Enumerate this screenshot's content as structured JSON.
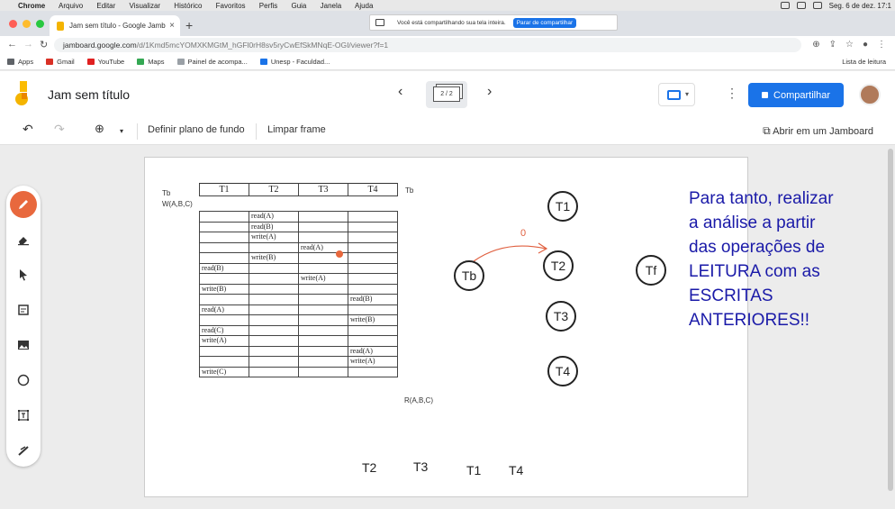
{
  "mac_menu": {
    "app": "Chrome",
    "items": [
      "Arquivo",
      "Editar",
      "Visualizar",
      "Histórico",
      "Favoritos",
      "Perfis",
      "Guia",
      "Janela",
      "Ajuda"
    ],
    "clock": "Seg. 6 de dez.  17:1"
  },
  "browser": {
    "tab_title": "Jam sem título - Google Jamb",
    "tab_close": "×",
    "new_tab": "+",
    "url_main": "jamboard.google.com",
    "url_path": "/d/1Kmd5mcYOMXKMGtM_hGFl0rH8sv5ryCwEfSkMNqE-OGI/viewer?f=1",
    "share_notice": "Você está compartilhando sua tela inteira.",
    "stop_sharing": "Parar de compartilhar",
    "bookmarks": [
      {
        "label": "Apps",
        "color": "#5f6368"
      },
      {
        "label": "Gmail",
        "color": "#d93025"
      },
      {
        "label": "YouTube",
        "color": "#e02020"
      },
      {
        "label": "Maps",
        "color": "#34a853"
      },
      {
        "label": "Painel de acompa...",
        "color": "#9aa0a6"
      },
      {
        "label": "Unesp - Faculdad...",
        "color": "#1a73e8"
      }
    ],
    "reading_list": "Lista de leitura"
  },
  "jam": {
    "title": "Jam sem título",
    "frame_counter": "2 / 2",
    "share_label": "Compartilhar",
    "accent": "#1a73e8"
  },
  "toolbar": {
    "set_background": "Definir plano de fundo",
    "clear_frame": "Limpar frame",
    "open_in_jamboard": "Abrir em um Jamboard"
  },
  "schedule": {
    "headers": [
      "T1",
      "T2",
      "T3",
      "T4"
    ],
    "left_label_tb": "Tb",
    "left_label_w": "W(A,B,C)",
    "right_label_tb": "Tb",
    "bottom_label_r": "R(A,B,C)",
    "rows": [
      [
        "",
        "read(A)",
        "",
        ""
      ],
      [
        "",
        "read(B)",
        "",
        ""
      ],
      [
        "",
        "write(A)",
        "",
        ""
      ],
      [
        "",
        "",
        "read(A)",
        ""
      ],
      [
        "",
        "write(B)",
        "",
        ""
      ],
      [
        "read(B)",
        "",
        "",
        ""
      ],
      [
        "",
        "",
        "write(A)",
        ""
      ],
      [
        "write(B)",
        "",
        "",
        ""
      ],
      [
        "",
        "",
        "",
        "read(B)"
      ],
      [
        "read(A)",
        "",
        "",
        ""
      ],
      [
        "",
        "",
        "",
        "write(B)"
      ],
      [
        "read(C)",
        "",
        "",
        ""
      ],
      [
        "write(A)",
        "",
        "",
        ""
      ],
      [
        "",
        "",
        "",
        "read(A)"
      ],
      [
        "",
        "",
        "",
        "write(A)"
      ],
      [
        "write(C)",
        "",
        "",
        ""
      ]
    ]
  },
  "graph": {
    "nodes": {
      "t1": "T1",
      "t2": "T2",
      "t3": "T3",
      "t4": "T4",
      "tb": "Tb",
      "tf": "Tf"
    },
    "edge_label": "0"
  },
  "note": "Para tanto, realizar\na análise a partir\ndas operações de\nLEITURA com as\nESCRITAS\nANTERIORES!!",
  "bottom_labels": [
    "T2",
    "T3",
    "T1",
    "T4"
  ]
}
